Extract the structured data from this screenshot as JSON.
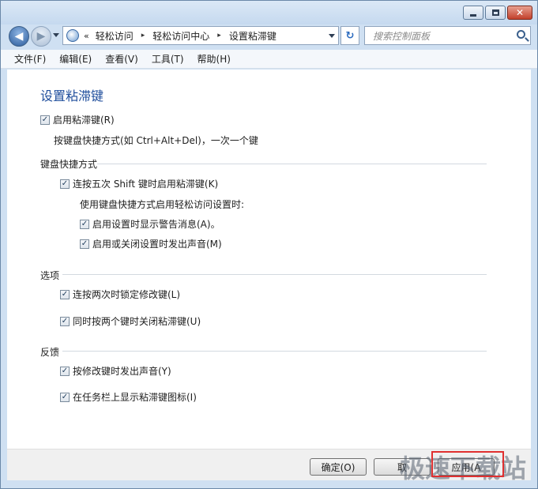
{
  "titlebar": {
    "min_icon": "minimize-icon",
    "max_icon": "maximize-icon",
    "close_icon": "close-icon",
    "close_glyph": "✕"
  },
  "nav": {
    "back_glyph": "◀",
    "forward_glyph": "▶",
    "address": {
      "prefix": "«",
      "crumbs": [
        "轻松访问",
        "轻松访问中心",
        "设置粘滞键"
      ],
      "separator": "▸"
    },
    "refresh_glyph": "↻",
    "search_placeholder": "搜索控制面板"
  },
  "menu": [
    "文件(F)",
    "编辑(E)",
    "查看(V)",
    "工具(T)",
    "帮助(H)"
  ],
  "page": {
    "title": "设置粘滞键",
    "enable_sticky": {
      "label": "启用粘滞键(R)",
      "checked": true
    },
    "enable_desc": "按键盘快捷方式(如 Ctrl+Alt+Del)，一次一个键",
    "keyboard_shortcut": {
      "heading": "键盘快捷方式",
      "shift5": {
        "label": "连按五次 Shift 键时启用粘滞键(K)",
        "checked": true
      },
      "sub_heading": "使用键盘快捷方式启用轻松访问设置时:",
      "warn": {
        "label": "启用设置时显示警告消息(A)。",
        "checked": true
      },
      "sound": {
        "label": "启用或关闭设置时发出声音(M)",
        "checked": true
      }
    },
    "options": {
      "heading": "选项",
      "lock": {
        "label": "连按两次时锁定修改键(L)",
        "checked": true
      },
      "turnoff": {
        "label": "同时按两个键时关闭粘滞键(U)",
        "checked": true
      }
    },
    "feedback": {
      "heading": "反馈",
      "beep": {
        "label": "按修改键时发出声音(Y)",
        "checked": true
      },
      "taskbar": {
        "label": "在任务栏上显示粘滞键图标(I)",
        "checked": true
      }
    }
  },
  "footer": {
    "ok": "确定(O)",
    "cancel": "取",
    "apply": "应用(A"
  },
  "watermark": {
    "text": "极速下载站",
    "box_color": "#e03030"
  },
  "colors": {
    "accent": "#1f4e9c",
    "chrome": "#cfe0f2"
  }
}
